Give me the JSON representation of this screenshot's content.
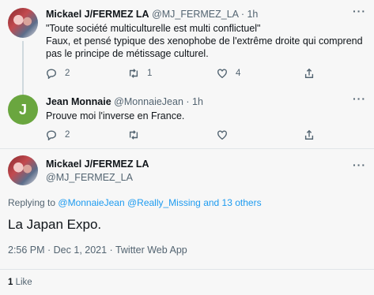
{
  "tweets": [
    {
      "name": "Mickael J/FERMEZ LA",
      "handle": "@MJ_FERMEZ_LA",
      "time": "· 1h",
      "line1": "\"Toute société multiculturelle est multi conflictuel\"",
      "line2": "Faux, et pensé typique des xenophobe de l'extrême droite qui comprend",
      "line3": "pas le principe de métissage culturel.",
      "replies": "2",
      "retweets": "1",
      "likes": "4"
    },
    {
      "name": "Jean Monnaie",
      "handle": "@MonnaieJean",
      "time": "· 1h",
      "avatar_letter": "J",
      "line1": "Prouve moi l'inverse en France.",
      "replies": "2"
    }
  ],
  "main": {
    "name": "Mickael J/FERMEZ LA",
    "handle": "@MJ_FERMEZ_LA",
    "replying_prefix": "Replying to",
    "replying_user1": "@MonnaieJean",
    "replying_user2": "@Really_Missing",
    "replying_others": "and 13 others",
    "text": "La Japan Expo.",
    "meta": "2:56 PM · Dec 1, 2021 · Twitter Web App",
    "like_count": "1",
    "like_label": "Like"
  },
  "icons": {
    "more": "more-icon",
    "reply": "reply-icon",
    "retweet": "retweet-icon",
    "like": "heart-icon",
    "share": "share-icon"
  },
  "colors": {
    "link": "#1d9bf0",
    "avatar_j": "#6aa63f"
  }
}
